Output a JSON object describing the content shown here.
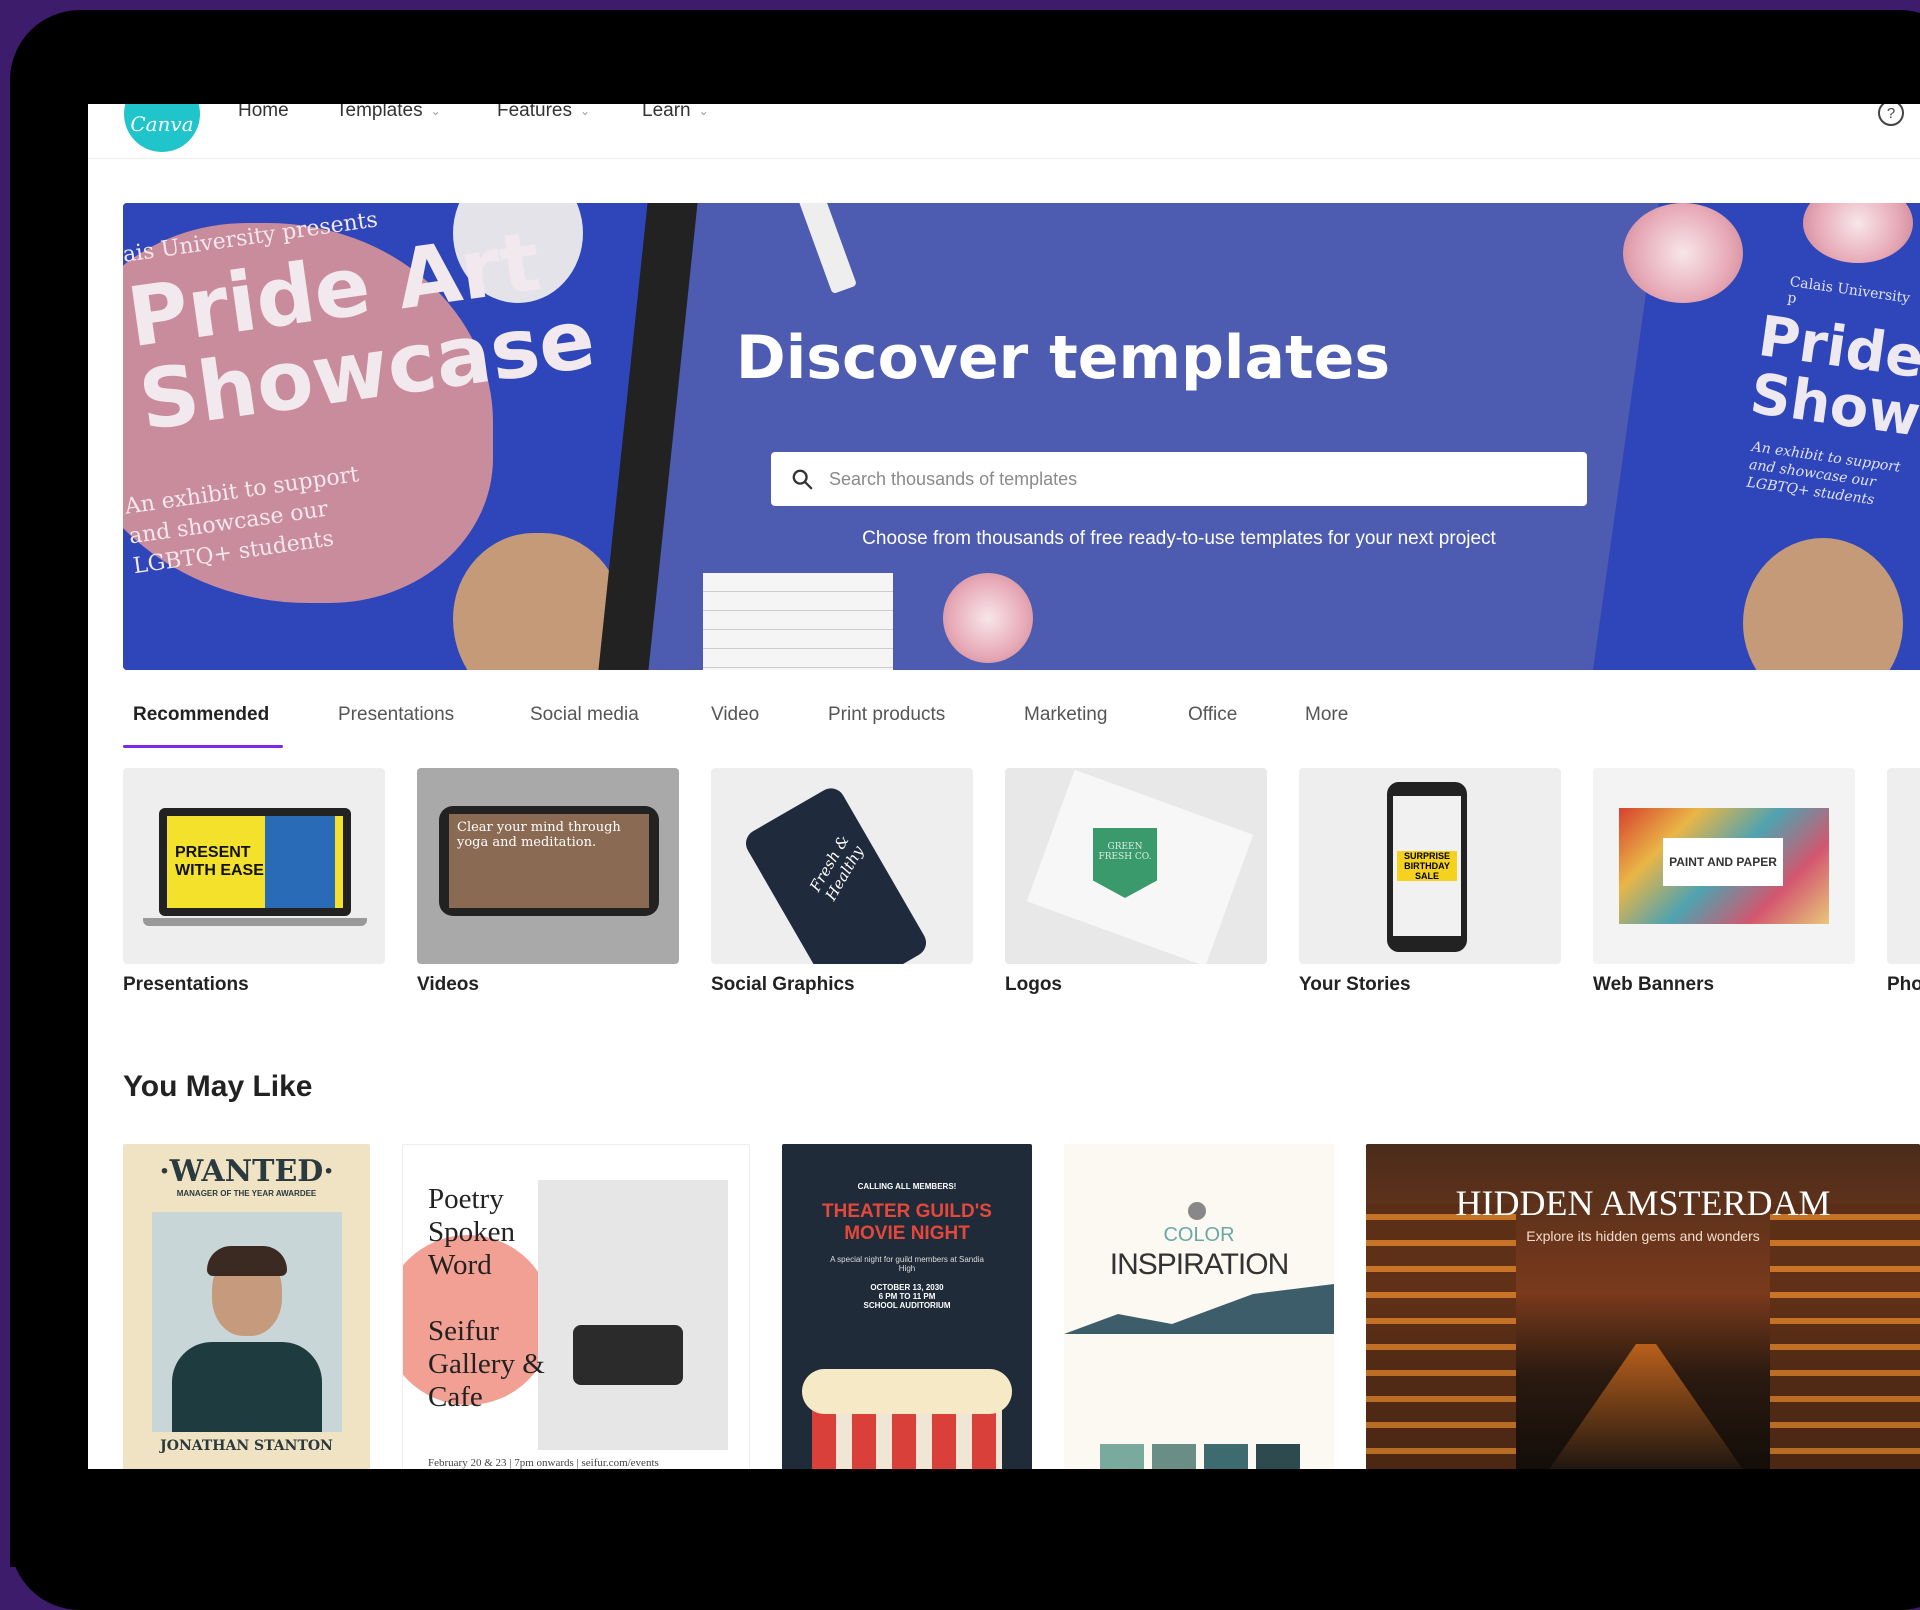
{
  "nav": {
    "logo": "Canva",
    "items": [
      {
        "label": "Home",
        "dropdown": false
      },
      {
        "label": "Templates",
        "dropdown": true
      },
      {
        "label": "Features",
        "dropdown": true
      },
      {
        "label": "Learn",
        "dropdown": true
      }
    ],
    "help_icon": "?"
  },
  "hero": {
    "title": "Discover templates",
    "search_placeholder": "Search thousands of templates",
    "subtitle": "Choose from thousands of free ready-to-use templates for your next project",
    "poster_left": {
      "subtitle": "ais University presents",
      "title": "Pride Art\nShowcase",
      "description": "An exhibit to support\nand showcase our\nLGBTQ+ students"
    },
    "poster_right": {
      "subtitle": "Calais University p",
      "title": "Pride\nShow",
      "description": "An exhibit to support\nand showcase our\nLGBTQ+ students"
    }
  },
  "tabs": [
    "Recommended",
    "Presentations",
    "Social media",
    "Video",
    "Print products",
    "Marketing",
    "Office",
    "More"
  ],
  "active_tab": "Recommended",
  "categories": [
    {
      "label": "Presentations",
      "thumb_text": "PRESENT WITH EASE"
    },
    {
      "label": "Videos",
      "thumb_text": "Clear your mind through yoga and meditation."
    },
    {
      "label": "Social Graphics",
      "thumb_text": "Fresh & Healthy"
    },
    {
      "label": "Logos",
      "thumb_text": "GREEN FRESH CO."
    },
    {
      "label": "Your Stories",
      "thumb_text": "SURPRISE BIRTHDAY SALE"
    },
    {
      "label": "Web Banners",
      "thumb_text": "PAINT AND PAPER"
    },
    {
      "label": "Pho"
    }
  ],
  "you_may_like": {
    "title": "You May Like",
    "templates": [
      {
        "heading": "·WANTED·",
        "sub": "MANAGER OF THE YEAR AWARDEE",
        "name": "JONATHAN STANTON"
      },
      {
        "lines": [
          "Poetry",
          "Spoken",
          "Word",
          "",
          "Seifur",
          "Gallery &",
          "Cafe"
        ],
        "footer": "February 20 & 23 | 7pm onwards | seifur.com/events"
      },
      {
        "kicker": "CALLING ALL MEMBERS!",
        "heading": "THEATER GUILD'S MOVIE NIGHT",
        "body": "A special night for guild members at Sandia High",
        "date": "OCTOBER 13, 2030",
        "time": "6 PM TO 11 PM",
        "place": "SCHOOL AUDITORIUM"
      },
      {
        "heading1": "COLOR",
        "heading2": "INSPIRATION"
      },
      {
        "heading": "HIDDEN AMSTERDAM",
        "sub": "Explore its hidden gems and wonders"
      }
    ]
  },
  "colors": {
    "background": "#3d1d6b",
    "accent": "#7d2ae8",
    "logo": "#20c4cb",
    "hero": "#4d5bb1"
  }
}
